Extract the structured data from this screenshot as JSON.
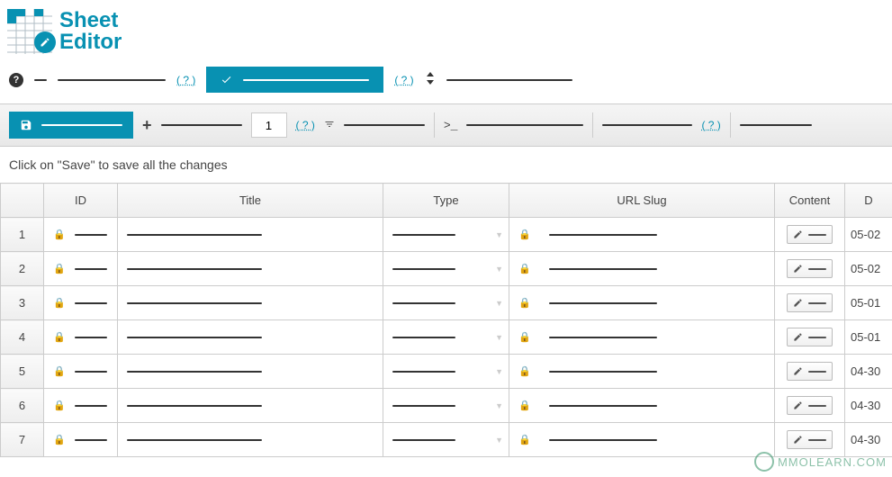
{
  "brand": {
    "top": "Sheet",
    "bottom": "Editor"
  },
  "toolbar1": {
    "help1": "( ? )",
    "help2": "( ? )"
  },
  "toolbar2": {
    "rows_value": "1",
    "help_add": "( ? )",
    "help_right": "( ? )"
  },
  "instruction": "Click on \"Save\" to save all the changes",
  "columns": {
    "num": "",
    "id": "ID",
    "title": "Title",
    "type": "Type",
    "slug": "URL Slug",
    "content": "Content",
    "date": "D"
  },
  "rows": [
    {
      "num": "1",
      "date": "05-02"
    },
    {
      "num": "2",
      "date": "05-02"
    },
    {
      "num": "3",
      "date": "05-01"
    },
    {
      "num": "4",
      "date": "05-01"
    },
    {
      "num": "5",
      "date": "04-30"
    },
    {
      "num": "6",
      "date": "04-30"
    },
    {
      "num": "7",
      "date": "04-30"
    }
  ],
  "watermark": "MMOLEARN.COM"
}
